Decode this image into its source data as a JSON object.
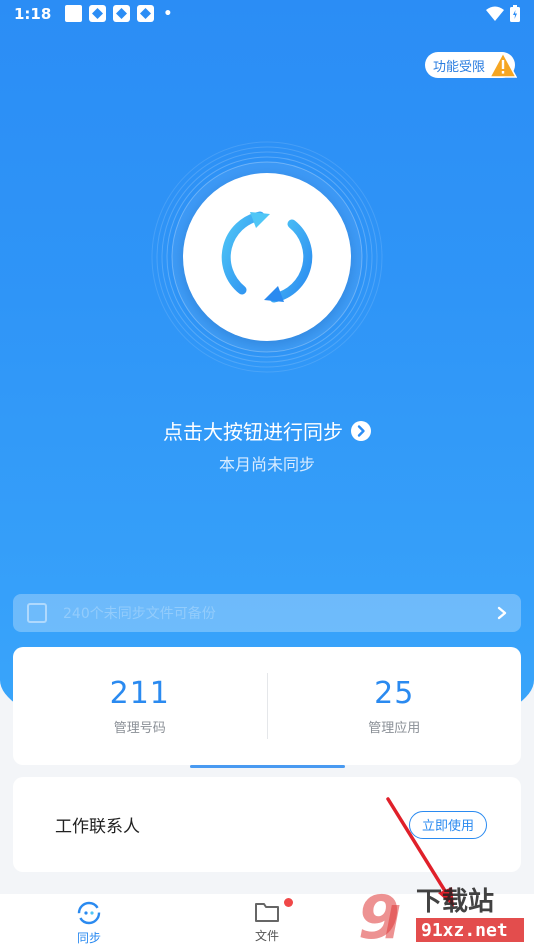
{
  "status_bar": {
    "time": "1:18",
    "dot": "•"
  },
  "header": {
    "limit_badge": "功能受限"
  },
  "sync": {
    "hint": "点击大按钮进行同步",
    "sub_hint": "本月尚未同步"
  },
  "notice": {
    "text": "240个未同步文件可备份"
  },
  "stats": [
    {
      "value": "211",
      "label": "管理号码"
    },
    {
      "value": "25",
      "label": "管理应用"
    }
  ],
  "contacts": {
    "title": "工作联系人",
    "button": "立即使用"
  },
  "tabs": [
    {
      "label": "同步",
      "icon": "sync-tab-icon",
      "active": true
    },
    {
      "label": "文件",
      "icon": "folder-icon",
      "active": false,
      "badge": true
    },
    {
      "label": "",
      "icon": "",
      "active": false
    }
  ],
  "watermark": {
    "line1": "下载站",
    "line2": "91xz.net"
  },
  "colors": {
    "primary": "#2a8af0",
    "hero_top": "#2b8df5",
    "hero_bottom": "#3aa6fb",
    "badge": "#f04848",
    "warning": "#f5a623"
  }
}
